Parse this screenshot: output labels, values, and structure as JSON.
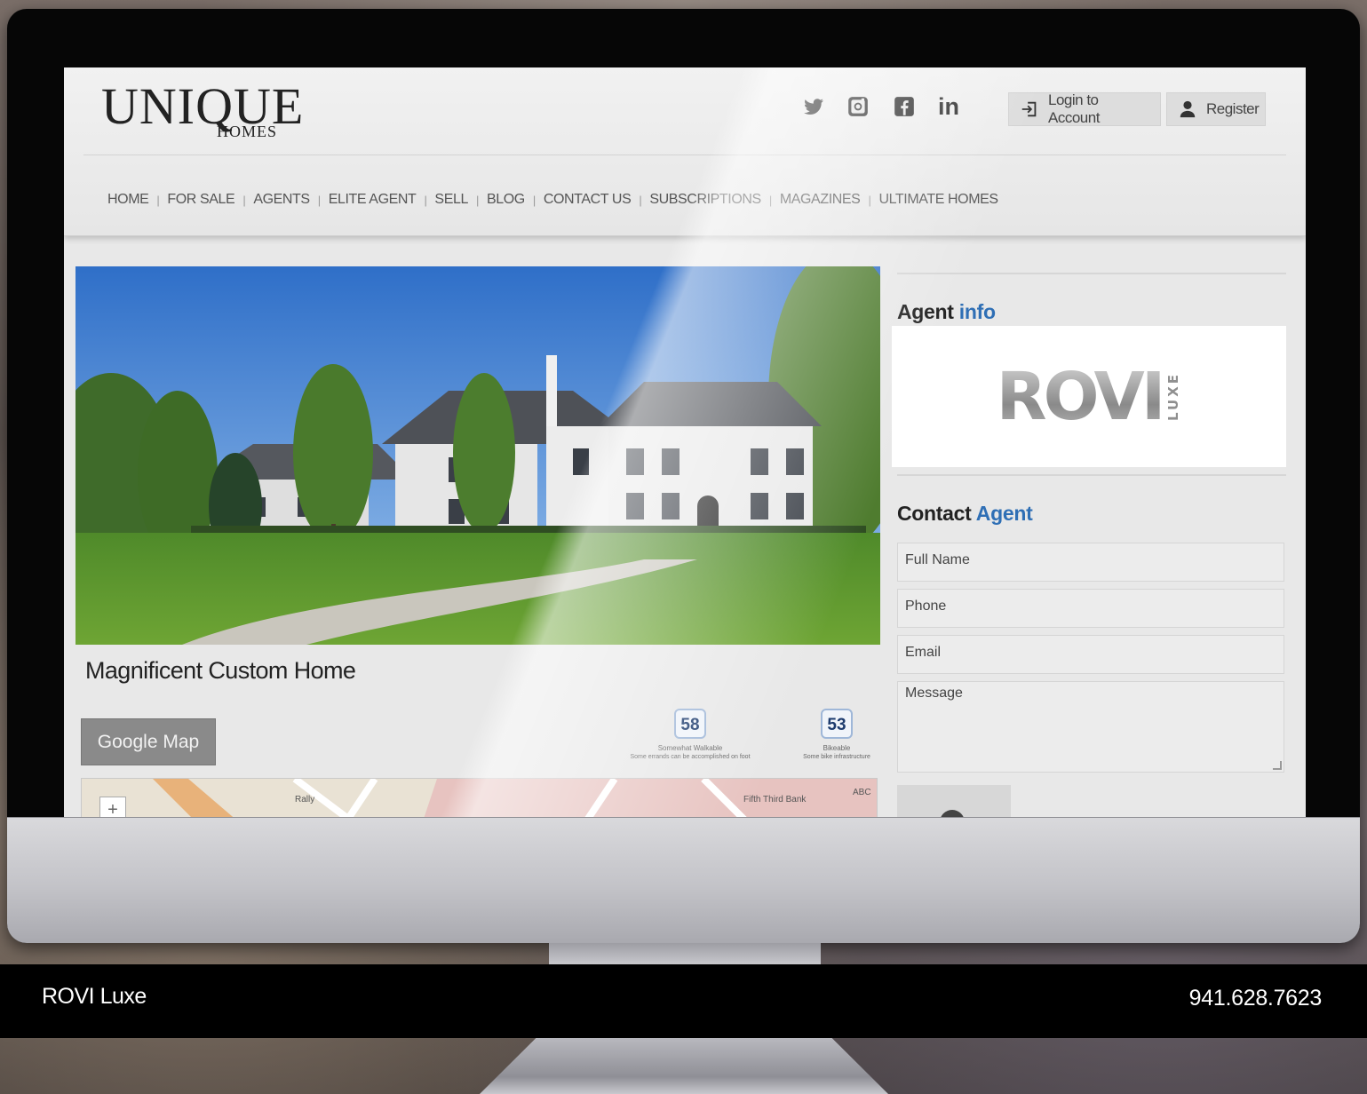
{
  "site": {
    "logo_main": "UNIQUE",
    "logo_sub": "HOMES"
  },
  "social": {
    "twitter_icon": "twitter-icon",
    "instagram_icon": "instagram-icon",
    "facebook_icon": "facebook-icon",
    "linkedin_label": "in"
  },
  "account": {
    "login_label": "Login to Account",
    "register_label": "Register"
  },
  "nav": {
    "items": [
      "HOME",
      "FOR SALE",
      "AGENTS",
      "ELITE AGENT",
      "SELL",
      "BLOG",
      "CONTACT US",
      "SUBSCRIPTIONS",
      "MAGAZINES",
      "ULTIMATE HOMES"
    ]
  },
  "listing": {
    "title": "Magnificent Custom Home",
    "map_button": "Google Map",
    "walk_score": "58",
    "walk_label": "Somewhat Walkable",
    "walk_desc": "Some errands can be accomplished on foot",
    "bike_score": "53",
    "bike_label": "Bikeable",
    "bike_desc": "Some bike infrastructure",
    "map_labels": {
      "rally": "Rally",
      "bank": "Fifth Third Bank",
      "abc": "ABC"
    }
  },
  "sidebar": {
    "agent_info_prefix": "Agent",
    "agent_info_accent": "info",
    "agent_logo_word": "ROVI",
    "agent_logo_tag": "LUXE",
    "contact_prefix": "Contact",
    "contact_accent": "Agent",
    "fields": {
      "full_name": "Full Name",
      "phone": "Phone",
      "email": "Email",
      "message": "Message"
    }
  },
  "footer": {
    "brand": "ROVI Luxe",
    "phone": "941.628.7623"
  },
  "colors": {
    "accent": "#2f6fb5",
    "footer_bg": "#000000"
  }
}
